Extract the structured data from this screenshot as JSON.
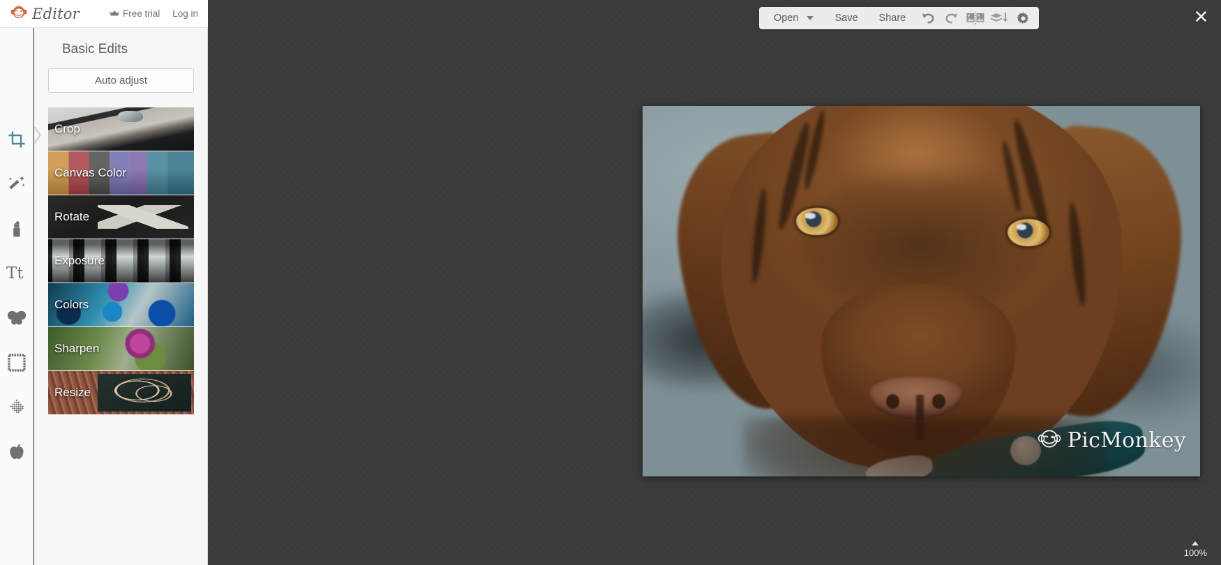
{
  "header": {
    "logo_text": "Editor",
    "logo_icon": "monkey-logo-icon",
    "free_trial_label": "Free trial",
    "free_trial_icon": "crown-icon",
    "login_label": "Log in"
  },
  "panel": {
    "title": "Basic Edits",
    "auto_adjust_label": "Auto adjust",
    "items": [
      {
        "label": "Crop",
        "thumb": "scissors-photo"
      },
      {
        "label": "Canvas Color",
        "thumb": "pastels-photo"
      },
      {
        "label": "Rotate",
        "thumb": "arrow-asphalt-photo"
      },
      {
        "label": "Exposure",
        "thumb": "windows-photo"
      },
      {
        "label": "Colors",
        "thumb": "paint-palette-photo"
      },
      {
        "label": "Sharpen",
        "thumb": "flower-macro-photo"
      },
      {
        "label": "Resize",
        "thumb": "hearts-photo"
      }
    ]
  },
  "rail": {
    "items": [
      {
        "name": "crop-tool",
        "icon": "crop-icon",
        "active": true
      },
      {
        "name": "touch-up-magic",
        "icon": "magic-wand-icon",
        "active": false
      },
      {
        "name": "touch-up",
        "icon": "lipstick-icon",
        "active": false
      },
      {
        "name": "text-tool",
        "icon": "text-tt-icon",
        "active": false
      },
      {
        "name": "overlays",
        "icon": "butterfly-icon",
        "active": false
      },
      {
        "name": "frames",
        "icon": "frame-icon",
        "active": false
      },
      {
        "name": "textures",
        "icon": "texture-icon",
        "active": false
      },
      {
        "name": "themes",
        "icon": "apple-icon",
        "active": false
      }
    ],
    "collapse_icon": "chevron-right-icon"
  },
  "toolbar": {
    "open_label": "Open",
    "open_caret_icon": "caret-down-icon",
    "save_label": "Save",
    "share_label": "Share",
    "undo_icon": "undo-arrow-icon",
    "redo_icon": "redo-arrow-icon",
    "compare_icon": "compare-images-icon",
    "flatten_icon": "flatten-layers-icon",
    "settings_icon": "gear-icon"
  },
  "workspace": {
    "close_icon": "close-x-icon",
    "close_label": "✕",
    "zoom_level": "100%",
    "zoom_caret_icon": "caret-up-icon",
    "watermark_text": "PicMonkey",
    "watermark_icon": "monkey-logo-icon",
    "image_subject": "brown-dog-portrait"
  },
  "colors": {
    "accent_teal": "#4d8a99",
    "logo_orange": "#d2693f",
    "workspace_bg": "#3b3b39",
    "panel_bg": "#f7f7f7",
    "toolbar_bg": "#ececea",
    "text_gray": "#5e5f61"
  }
}
